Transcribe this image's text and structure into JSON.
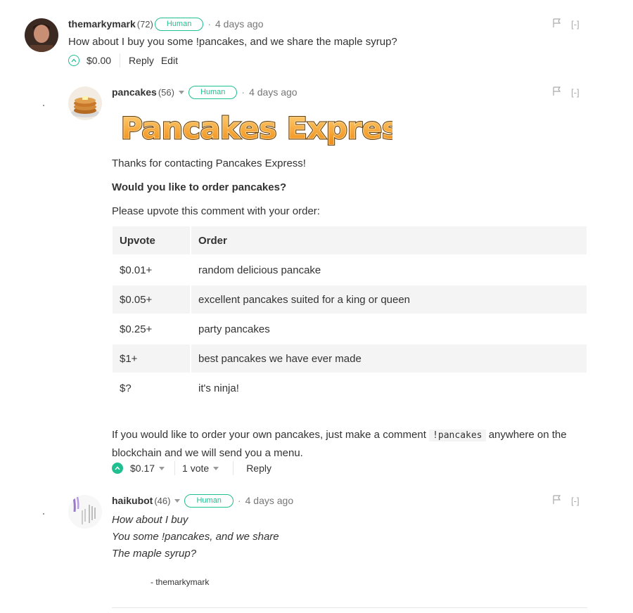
{
  "comments": [
    {
      "author": "themarkymark",
      "reputation": "(72)",
      "badge": "Human",
      "time": "4 days ago",
      "body": "How about I buy you some !pancakes, and we share the maple syrup?",
      "payout": "$0.00",
      "reply_label": "Reply",
      "edit_label": "Edit",
      "collapse_label": "[-]"
    },
    {
      "author": "pancakes",
      "reputation": "(56)",
      "badge": "Human",
      "time": "4 days ago",
      "banner_text": "Pancakes Express",
      "intro": "Thanks for contacting Pancakes Express!",
      "question": "Would you like to order pancakes?",
      "prompt": "Please upvote this comment with your order:",
      "table": {
        "headers": [
          "Upvote",
          "Order"
        ],
        "rows": [
          [
            "$0.01+",
            "random delicious pancake"
          ],
          [
            "$0.05+",
            "excellent pancakes suited for a king or queen"
          ],
          [
            "$0.25+",
            "party pancakes"
          ],
          [
            "$1+",
            "best pancakes we have ever made"
          ],
          [
            "$?",
            "it's ninja!"
          ]
        ]
      },
      "footer_before": "If you would like to order your own pancakes, just make a comment",
      "footer_code": "!pancakes",
      "footer_after": "anywhere on the",
      "footer_line2": "blockchain and we will send you a menu.",
      "payout": "$0.17",
      "votes": "1 vote",
      "reply_label": "Reply",
      "collapse_label": "[-]"
    },
    {
      "author": "haikubot",
      "reputation": "(46)",
      "badge": "Human",
      "time": "4 days ago",
      "lines": [
        "How about I buy",
        "You some !pancakes, and we share",
        "The maple syrup?"
      ],
      "signature": "- themarkymark",
      "collapse_label": "[-]"
    }
  ],
  "colors": {
    "accent": "#1fbf8f",
    "muted": "#777777"
  }
}
